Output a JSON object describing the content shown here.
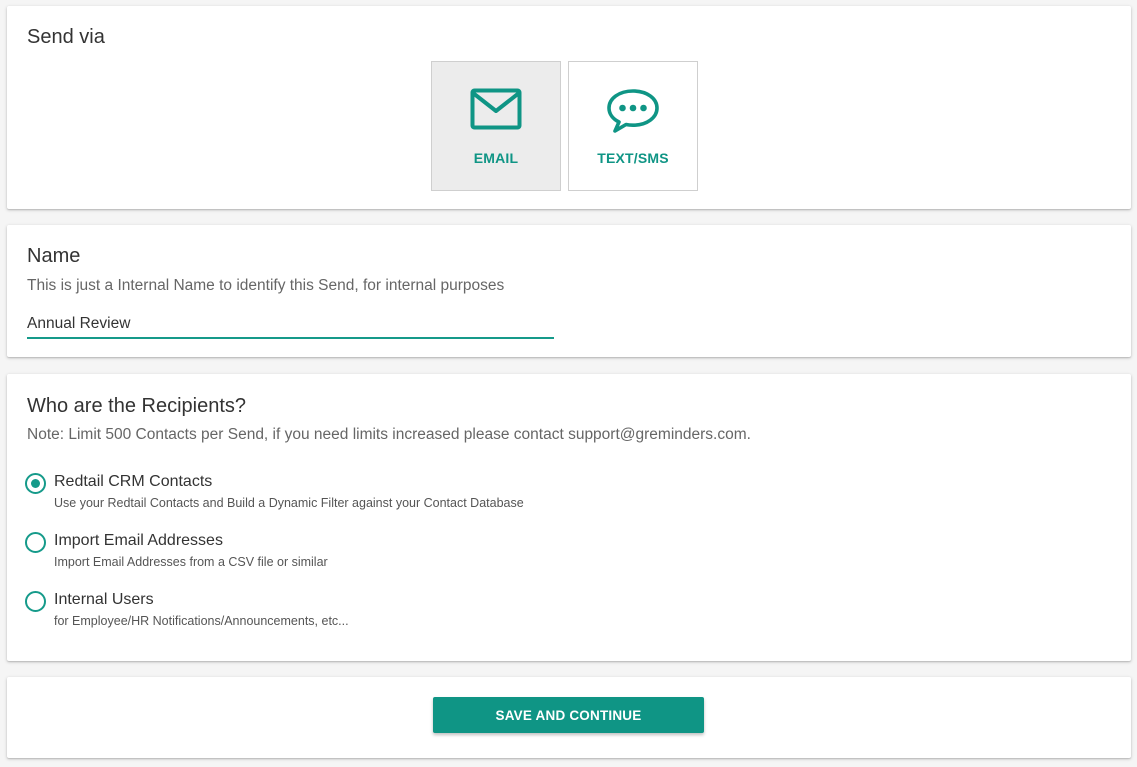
{
  "send_via": {
    "title": "Send via",
    "options": [
      {
        "label": "EMAIL",
        "icon": "envelope-icon",
        "selected": true
      },
      {
        "label": "TEXT/SMS",
        "icon": "chat-bubble-icon",
        "selected": false
      }
    ]
  },
  "name_section": {
    "title": "Name",
    "subtitle": "This is just a Internal Name to identify this Send, for internal purposes",
    "input_value": "Annual Review"
  },
  "recipients": {
    "title": "Who are the Recipients?",
    "note": "Note: Limit 500 Contacts per Send, if you need limits increased please contact support@greminders.com.",
    "options": [
      {
        "label": "Redtail CRM Contacts",
        "description": "Use your Redtail Contacts and Build a Dynamic Filter against your Contact Database",
        "checked": true
      },
      {
        "label": "Import Email Addresses",
        "description": "Import Email Addresses from a CSV file or similar",
        "checked": false
      },
      {
        "label": "Internal Users",
        "description": "for Employee/HR Notifications/Announcements, etc...",
        "checked": false
      }
    ]
  },
  "actions": {
    "save_label": "SAVE AND CONTINUE"
  },
  "colors": {
    "accent": "#0f9585",
    "selected_bg": "#ececec",
    "page_bg": "#f5f5f5"
  }
}
